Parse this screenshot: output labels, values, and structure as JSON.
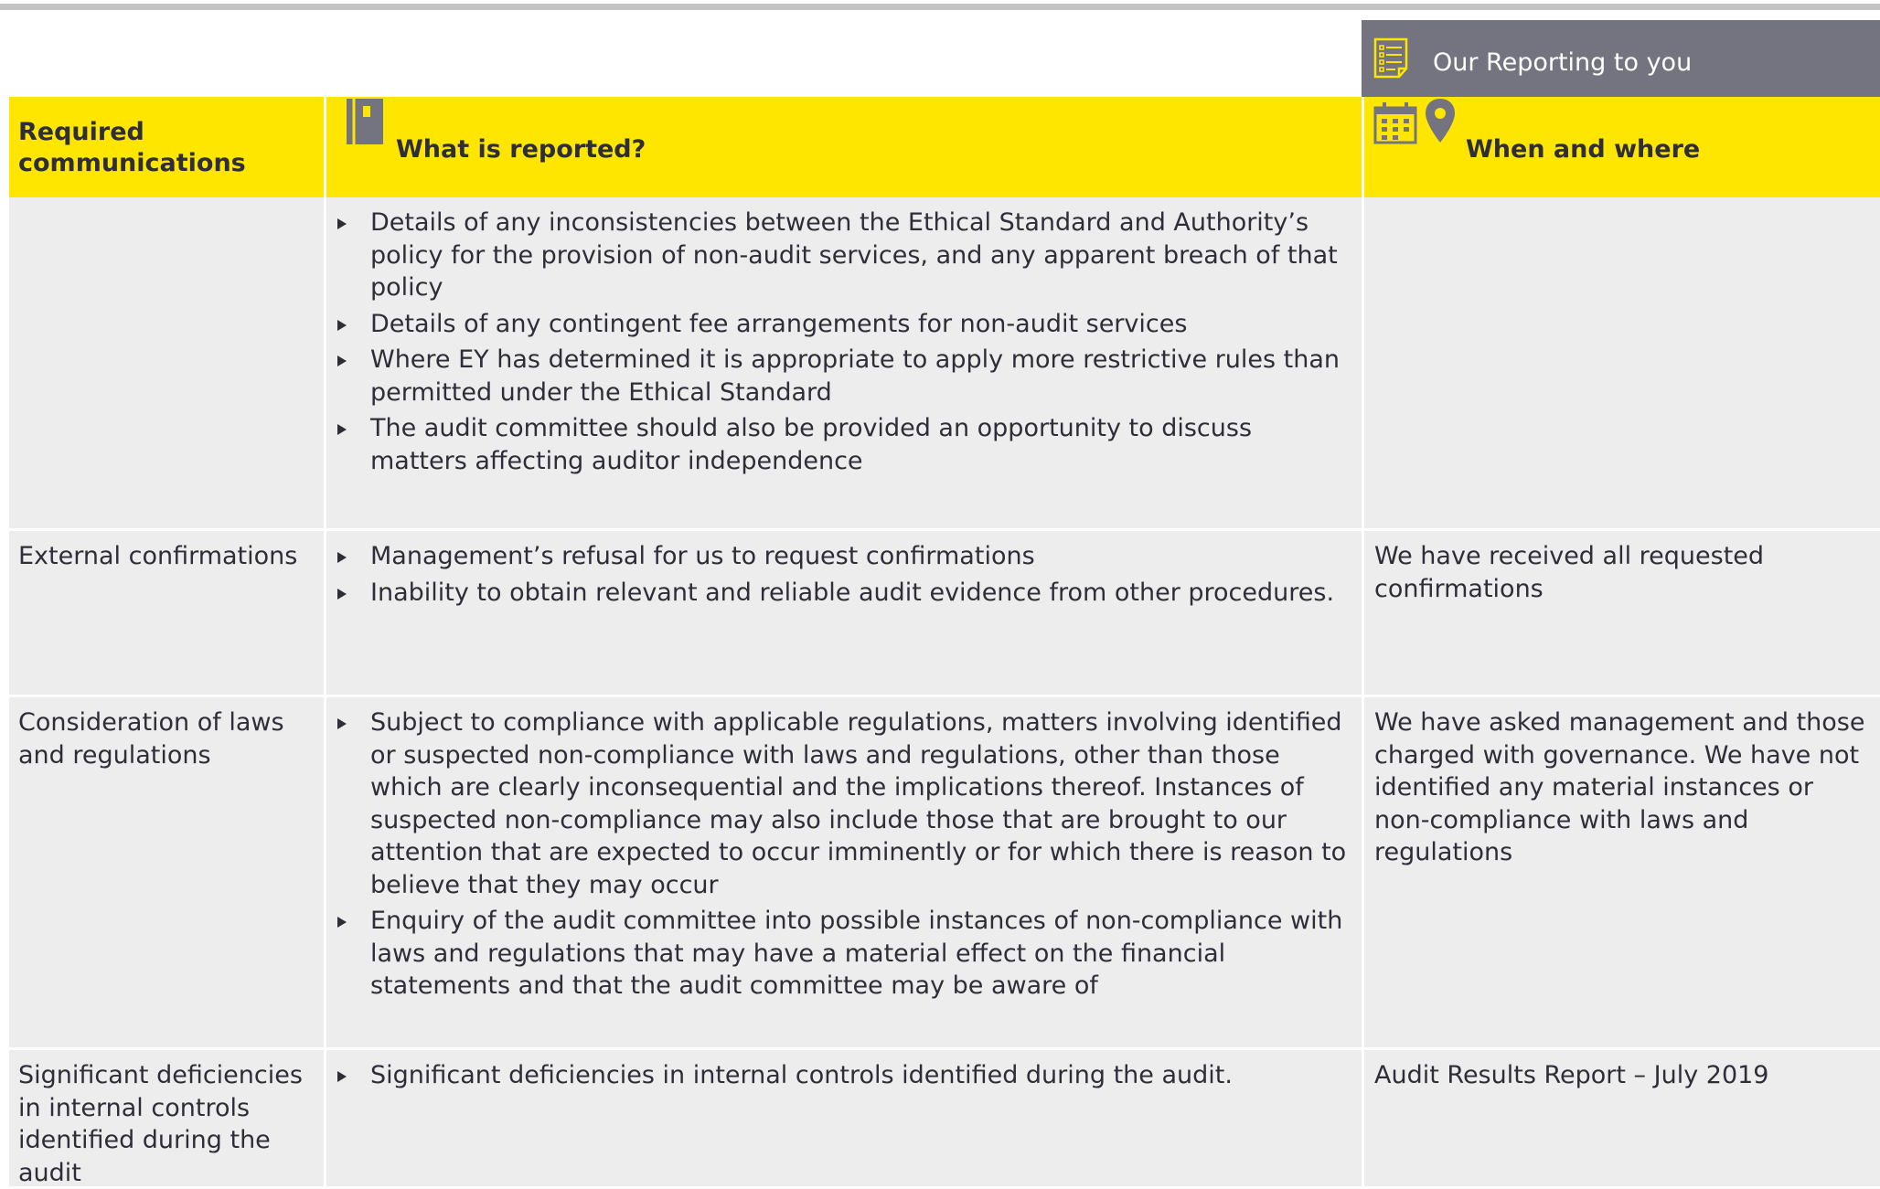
{
  "reporting_tab": {
    "label": "Our Reporting to you"
  },
  "header": {
    "col1": "Required communications",
    "col2": "What is reported?",
    "col3": "When and where"
  },
  "colors": {
    "accent_yellow": "#ffe600",
    "tab_grey": "#747480",
    "row_bg": "#ededed",
    "text": "#2e2e38"
  },
  "icons": [
    "checklist-icon",
    "notebook-icon",
    "calendar-icon",
    "location-pin-icon"
  ],
  "rows": [
    {
      "title": "",
      "bullets": [
        "Details of any inconsistencies between the Ethical Standard and Authority’s policy for the provision of non-audit services, and any apparent breach of that policy",
        "Details of any contingent fee arrangements for non-audit services",
        "Where EY has determined it is appropriate to apply more restrictive rules than permitted under the Ethical Standard",
        "The audit committee should also be provided an opportunity to discuss matters affecting auditor independence"
      ],
      "when": ""
    },
    {
      "title": "External confirmations",
      "bullets": [
        "Management’s refusal for us to request confirmations",
        "Inability to obtain relevant and reliable audit evidence from other procedures."
      ],
      "when": "We have received all requested confirmations"
    },
    {
      "title": "Consideration of laws and regulations",
      "bullets": [
        "Subject to compliance with applicable regulations, matters involving identified or suspected non-compliance with laws and regulations, other than those which are clearly inconsequential and the implications thereof. Instances of suspected non-compliance may also include those that are brought to our attention that are expected to occur imminently or for which there is reason to believe that they may occur",
        "Enquiry of the audit committee into possible instances of non-compliance with laws and regulations that may have a material effect on the financial statements and that the audit committee may be aware of"
      ],
      "when": "We have asked management and those charged with governance. We have not identified any material instances or non-compliance with laws and regulations"
    },
    {
      "title": "Significant deficiencies in internal controls identified during the audit",
      "bullets": [
        "Significant deficiencies in internal controls identified during the audit."
      ],
      "when": "Audit Results Report – July 2019"
    }
  ]
}
